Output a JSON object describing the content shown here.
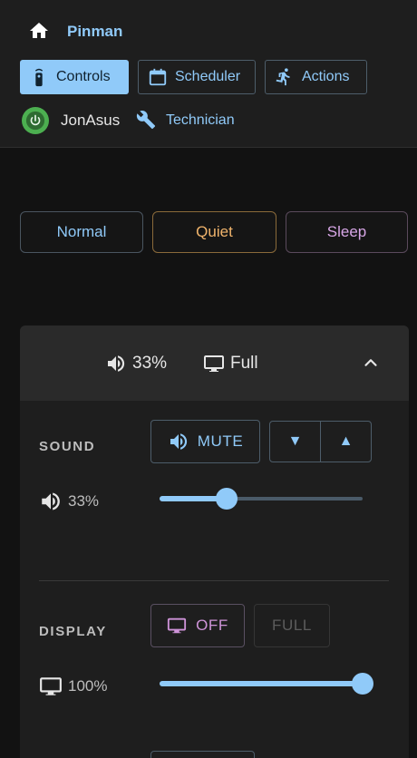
{
  "app": {
    "title": "Pinman",
    "home_icon": "home-icon"
  },
  "nav": {
    "controls_label": "Controls",
    "scheduler_label": "Scheduler",
    "actions_label": "Actions"
  },
  "user": {
    "name": "JonAsus",
    "role": "Technician",
    "status_color": "#4caf50"
  },
  "modes": {
    "normal": "Normal",
    "quiet": "Quiet",
    "sleep": "Sleep"
  },
  "summary": {
    "volume": "33%",
    "display": "Full"
  },
  "sound": {
    "label": "SOUND",
    "mute_label": "MUTE",
    "down_glyph": "▼",
    "up_glyph": "▲",
    "level_text": "33%",
    "level": 0.33
  },
  "display": {
    "label": "DISPLAY",
    "off_label": "OFF",
    "full_label": "FULL",
    "level_text": "100%",
    "level": 1.0
  },
  "colors": {
    "accent": "#90caf9",
    "quiet": "#f0b46c",
    "sleep": "#d7a6e6",
    "display_off": "#ce93d8"
  }
}
